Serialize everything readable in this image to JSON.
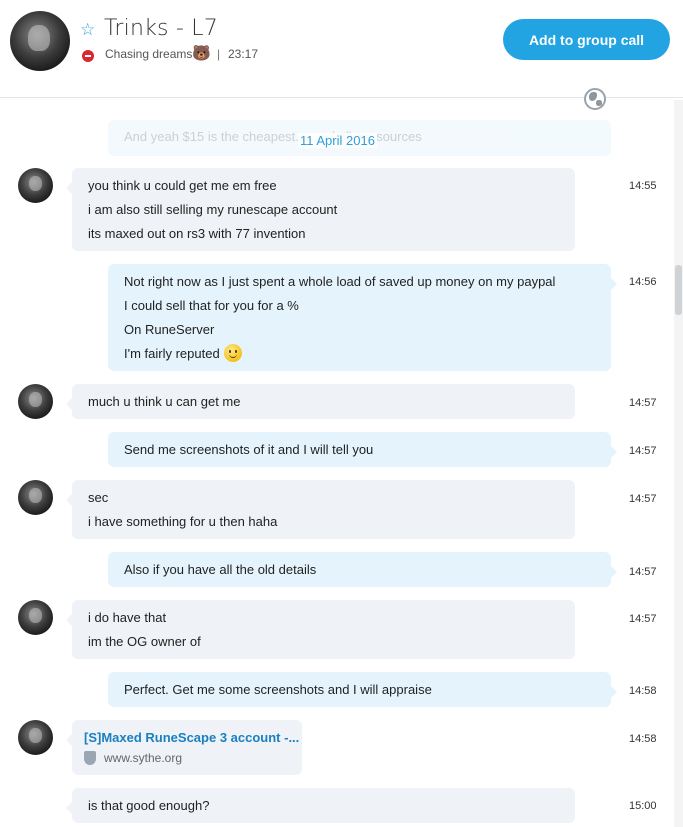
{
  "header": {
    "contact_name": "Trinks - L7",
    "mood": "Chasing dreams",
    "mood_emoji": "🐻",
    "separator": "|",
    "local_time": "23:17",
    "call_button": "Add to group call",
    "accent_color": "#22a3e2",
    "status_color": "#d9272e",
    "status": "do-not-disturb"
  },
  "conversation": {
    "faded_message": "And yeah $15 is the cheapest... ...ed all my sources",
    "date_divider": "11 April 2016",
    "messages": [
      {
        "from": "them",
        "lines": [
          "you think u could get me em free",
          "i am also still selling my runescape account",
          "its maxed out on rs3 with 77 invention"
        ],
        "time": "14:55"
      },
      {
        "from": "me",
        "lines": [
          "Not right now as I just spent a whole load of saved up money on my paypal",
          "I could sell that for you for a %",
          "On RuneServer",
          "I'm fairly reputed"
        ],
        "time": "14:56"
      },
      {
        "from": "them",
        "lines": [
          "much u think u can get me"
        ],
        "time": "14:57"
      },
      {
        "from": "me",
        "lines": [
          "Send me screenshots of it and I will tell you"
        ],
        "time": "14:57"
      },
      {
        "from": "them",
        "lines": [
          "sec",
          "i have something for u then haha"
        ],
        "time": "14:57"
      },
      {
        "from": "me",
        "lines": [
          "Also if you have all the old details"
        ],
        "time": "14:57"
      },
      {
        "from": "them",
        "lines": [
          "i do have that",
          "im the OG owner of"
        ],
        "time": "14:57"
      },
      {
        "from": "me",
        "lines": [
          "Perfect. Get me some screenshots and I will appraise"
        ],
        "time": "14:58"
      },
      {
        "from": "them",
        "link_title": "[S]Maxed RuneScape 3 account -...",
        "link_site": "www.sythe.org",
        "time": "14:58"
      },
      {
        "from": "them",
        "lines": [
          "is that good enough?"
        ],
        "time": "15:00"
      }
    ]
  }
}
